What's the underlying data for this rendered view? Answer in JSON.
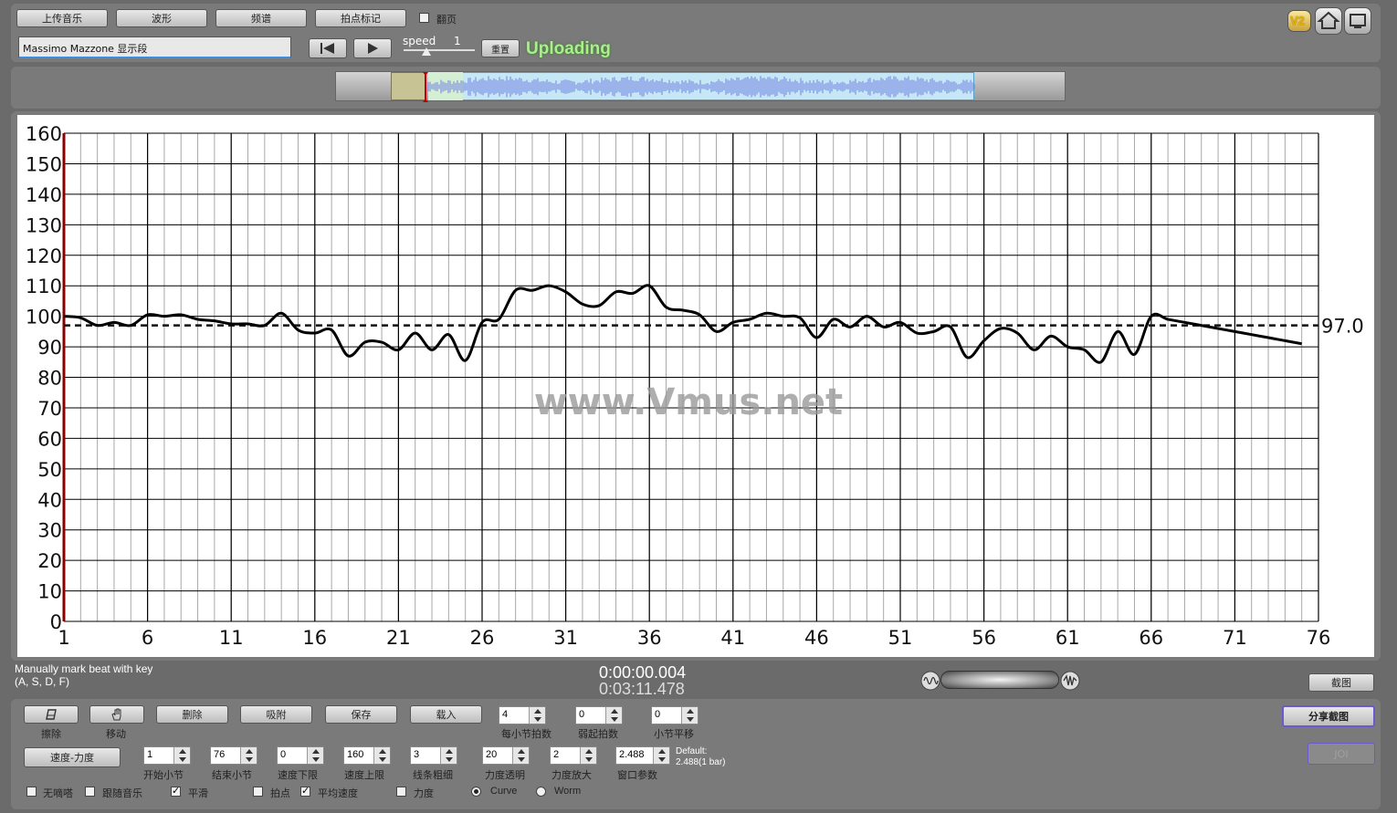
{
  "toolbar": {
    "upload_label": "上传音乐",
    "waveform_label": "波形",
    "spectrum_label": "频谱",
    "beat_mark_label": "拍点标记",
    "page_turn_label": "翻页",
    "track_title": "Massimo Mazzone 显示段",
    "speed_label": "speed",
    "speed_value": "1",
    "reset_label": "重置",
    "status_text": "Uploading",
    "version_badge": "V2",
    "icons": [
      "home-icon",
      "screen-icon",
      "skip-start-icon",
      "play-icon"
    ]
  },
  "chart_data": {
    "type": "line",
    "xlim": [
      1,
      76
    ],
    "ylim": [
      0,
      160
    ],
    "x_ticks": [
      1,
      6,
      11,
      16,
      21,
      26,
      31,
      36,
      41,
      46,
      51,
      56,
      61,
      66,
      71,
      76
    ],
    "y_ticks": [
      0,
      10,
      20,
      30,
      40,
      50,
      60,
      70,
      80,
      90,
      100,
      110,
      120,
      130,
      140,
      150,
      160
    ],
    "average": 97.0,
    "average_label": "97.0",
    "watermark": "www.Vmus.net",
    "grid": true,
    "series": [
      {
        "x": [
          1,
          2,
          3,
          4,
          5,
          6,
          7,
          8,
          9,
          10,
          11,
          12,
          13,
          14,
          15,
          16,
          17,
          18,
          19,
          20,
          21,
          22,
          23,
          24,
          25,
          26,
          27,
          28,
          29,
          30,
          31,
          32,
          33,
          34,
          35,
          36,
          37,
          38,
          39,
          40,
          41,
          42,
          43,
          44,
          45,
          46,
          47,
          48,
          49,
          50,
          51,
          52,
          53,
          54,
          55,
          56,
          57,
          58,
          59,
          60,
          61,
          62,
          63,
          64,
          65,
          66,
          67,
          68,
          69,
          70,
          71,
          72,
          73,
          74,
          75
        ],
        "values": [
          100,
          99.5,
          97,
          98,
          97,
          100.5,
          100,
          100.5,
          99,
          98.5,
          97.5,
          97.5,
          97,
          101,
          95.5,
          94.5,
          95.5,
          87,
          91.5,
          91.5,
          89,
          94.5,
          89,
          94,
          85.5,
          98,
          99,
          108.5,
          108.5,
          110,
          108,
          104,
          103.5,
          108,
          107.5,
          110,
          103,
          102,
          100.5,
          95,
          98,
          99,
          101,
          100,
          99.5,
          93,
          99,
          96.5,
          100,
          96.5,
          98,
          94.5,
          95,
          96.5,
          86.5,
          92,
          96,
          94.5,
          89,
          93.5,
          90,
          89,
          85,
          95,
          87.5,
          100,
          99,
          98,
          97,
          96,
          95,
          94,
          93,
          92,
          91
        ]
      }
    ]
  },
  "status": {
    "hint_line1": "Manually mark beat with key",
    "hint_line2": "(A, S, D, F)",
    "time_current": "0:00:00.004",
    "time_total": "0:03:11.478",
    "screenshot_label": "截图"
  },
  "controls": {
    "erase_label": "擦除",
    "move_label": "移动",
    "delete_label": "删除",
    "snap_label": "吸附",
    "save_label": "保存",
    "load_label": "载入",
    "beats_per_bar_value": "4",
    "beats_per_bar_label": "每小节拍数",
    "pickup_value": "0",
    "pickup_label": "弱起拍数",
    "bar_offset_value": "0",
    "bar_offset_label": "小节平移",
    "mode_label": "速度-力度",
    "start_bar_value": "1",
    "start_bar_label": "开始小节",
    "end_bar_value": "76",
    "end_bar_label": "结束小节",
    "tempo_min_value": "0",
    "tempo_min_label": "速度下限",
    "tempo_max_value": "160",
    "tempo_max_label": "速度上限",
    "line_width_value": "3",
    "line_width_label": "线条粗细",
    "dyn_opacity_value": "20",
    "dyn_opacity_label": "力度透明",
    "dyn_scale_value": "2",
    "dyn_scale_label": "力度放大",
    "window_value": "2.488",
    "window_label": "窗口参数",
    "default_line1": "Default:",
    "default_line2": "2.488(1 bar)",
    "share_label": "分享截图",
    "joi_label": "JOI",
    "cb_no_ticks": "无嘀嗒",
    "cb_follow": "跟随音乐",
    "cb_smooth": "平滑",
    "cb_beats": "拍点",
    "cb_avg_tempo": "平均速度",
    "cb_dynamics": "力度",
    "radio_curve": "Curve",
    "radio_worm": "Worm"
  }
}
